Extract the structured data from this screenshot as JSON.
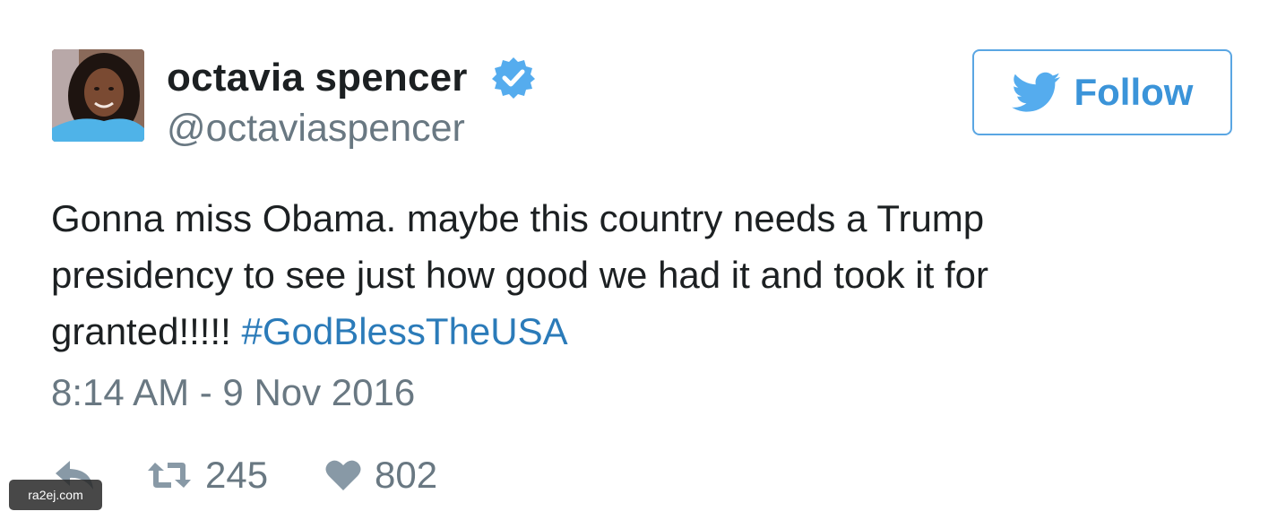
{
  "user": {
    "display_name": "octavia spencer",
    "handle": "@octaviaspencer",
    "verified": true,
    "avatar_icon": "profile-photo"
  },
  "follow_button": {
    "label": "Follow",
    "icon": "twitter-bird-icon",
    "color": "#3b94d9",
    "border_color": "#5aa6e3"
  },
  "tweet": {
    "text": "Gonna miss Obama. maybe this country needs a Trump presidency to see just how good we had it and took it for granted!!!!! ",
    "hashtag": "#GodBlessTheUSA",
    "hashtag_color": "#2b7bb9",
    "timestamp": "8:14 AM - 9 Nov 2016"
  },
  "actions": {
    "reply_icon": "reply-icon",
    "retweet_icon": "retweet-icon",
    "retweet_count": "245",
    "like_icon": "heart-icon",
    "like_count": "802"
  },
  "watermark": {
    "text": "ra2ej.com"
  }
}
